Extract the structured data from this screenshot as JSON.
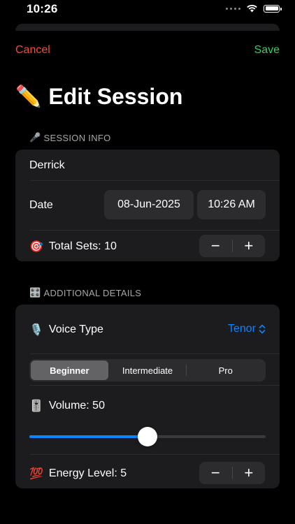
{
  "status_bar": {
    "time": "10:26"
  },
  "nav": {
    "cancel_label": "Cancel",
    "save_label": "Save"
  },
  "title": {
    "emoji": "✏️",
    "text": "Edit Session"
  },
  "session_info": {
    "header_emoji": "🎤",
    "header": "SESSION INFO",
    "name_value": "Derrick",
    "date_label": "Date",
    "date_value": "08-Jun-2025",
    "time_value": "10:26 AM",
    "total_sets_emoji": "🎯",
    "total_sets_label": "Total Sets: 10",
    "total_sets": 10,
    "stepper_minus": "−",
    "stepper_plus": "+"
  },
  "additional_details": {
    "header_emoji": "🎛️",
    "header": "ADDITIONAL DETAILS",
    "voice_type_emoji": "🎙️",
    "voice_type_label": "Voice Type",
    "voice_type_value": "Tenor",
    "voice_type_chevron": "⌃⌄",
    "levels": [
      "Beginner",
      "Intermediate",
      "Pro"
    ],
    "selected_level": "Beginner",
    "volume_emoji": "🎚️",
    "volume_label": "Volume: 50",
    "volume": 50,
    "volume_fraction": 0.5,
    "energy_emoji": "💯",
    "energy_label": "Energy Level: 5",
    "energy_level": 5,
    "stepper_minus": "−",
    "stepper_plus": "+"
  },
  "colors": {
    "accent": "#0a84ff",
    "cancel": "#ff453a",
    "save": "#30d158",
    "card": "#1c1c1e"
  },
  "icons": [
    "cellular-signal-icon",
    "wifi-icon",
    "battery-icon",
    "chevron-updown-icon"
  ]
}
